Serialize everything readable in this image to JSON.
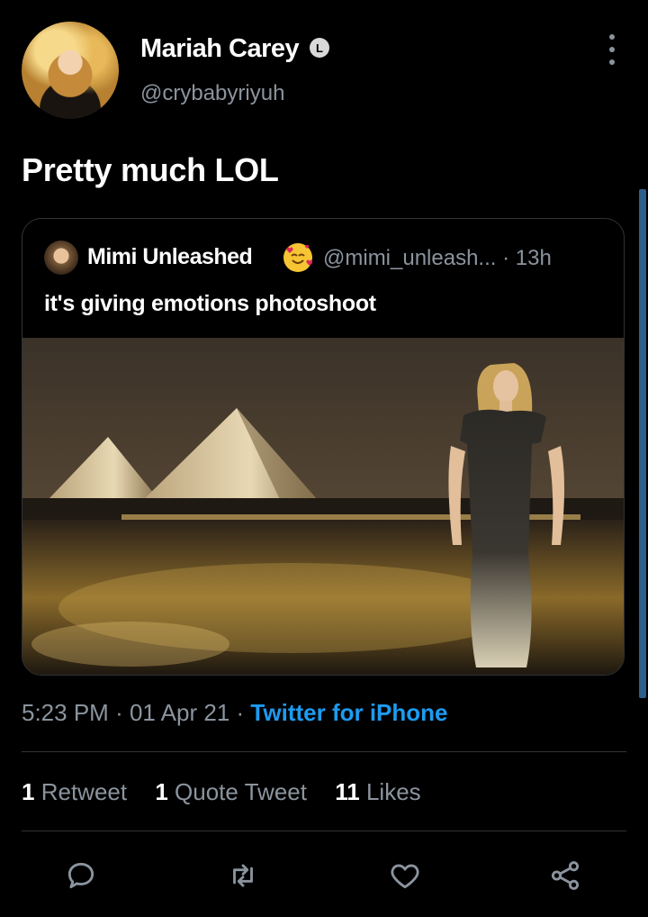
{
  "author": {
    "display_name": "Mariah Carey",
    "verified_badge": "L",
    "handle": "@crybabyriyuh"
  },
  "tweet": {
    "text": "Pretty much LOL"
  },
  "quoted": {
    "display_name": "Mimi Unleashed",
    "emoji": "🥰",
    "handle": "@mimi_unleash...",
    "time": "· 13h",
    "text": "it's giving emotions photoshoot"
  },
  "meta": {
    "time": "5:23 PM",
    "date": "01 Apr 21",
    "separator": "·",
    "source": "Twitter for iPhone"
  },
  "stats": {
    "retweets_count": "1",
    "retweets_label": "Retweet",
    "quotes_count": "1",
    "quotes_label": "Quote Tweet",
    "likes_count": "11",
    "likes_label": "Likes"
  },
  "colors": {
    "background": "#000000",
    "secondary_text": "#8b949e",
    "link": "#1d9bf0",
    "divider": "#2f3336"
  },
  "icons": [
    "more-icon",
    "verified-icon",
    "reply-icon",
    "retweet-icon",
    "like-icon",
    "share-icon"
  ]
}
